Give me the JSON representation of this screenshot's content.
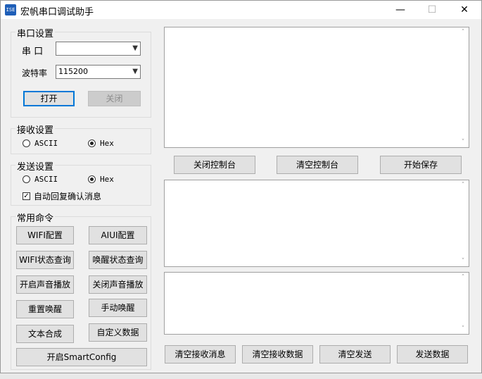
{
  "window": {
    "title": "宏帆串口调试助手",
    "icon_label": "ISE",
    "minimize_glyph": "—",
    "maximize_glyph": "☐",
    "close_glyph": "✕"
  },
  "serial_settings": {
    "title": "串口设置",
    "port_label": "串  口",
    "port_value": "",
    "baud_label": "波特率",
    "baud_value": "115200",
    "open_button": "打开",
    "close_button": "关闭"
  },
  "receive_settings": {
    "title": "接收设置",
    "option_ascii": "ASCII",
    "option_hex": "Hex",
    "selected": "Hex"
  },
  "send_settings": {
    "title": "发送设置",
    "option_ascii": "ASCII",
    "option_hex": "Hex",
    "selected": "Hex",
    "auto_reply_label": "自动回复确认消息",
    "auto_reply_checked": true
  },
  "commands": {
    "title": "常用命令",
    "buttons": [
      "WIFI配置",
      "AIUI配置",
      "WIFI状态查询",
      "唤醒状态查询",
      "开启声音播放",
      "关闭声音播放",
      "重置唤醒",
      "手动唤醒",
      "文本合成",
      "自定义数据"
    ],
    "smartconfig": "开启SmartConfig"
  },
  "console_buttons": {
    "close_console": "关闭控制台",
    "clear_console": "清空控制台",
    "start_save": "开始保存"
  },
  "bottom_buttons": {
    "clear_recv_msg": "清空接收消息",
    "clear_recv_data": "清空接收数据",
    "clear_send": "清空发送",
    "send_data": "发送数据"
  },
  "scroll": {
    "up": "˄",
    "down": "˅"
  },
  "colors": {
    "accent": "#0078d7",
    "window_bg": "#f0f0f0"
  }
}
